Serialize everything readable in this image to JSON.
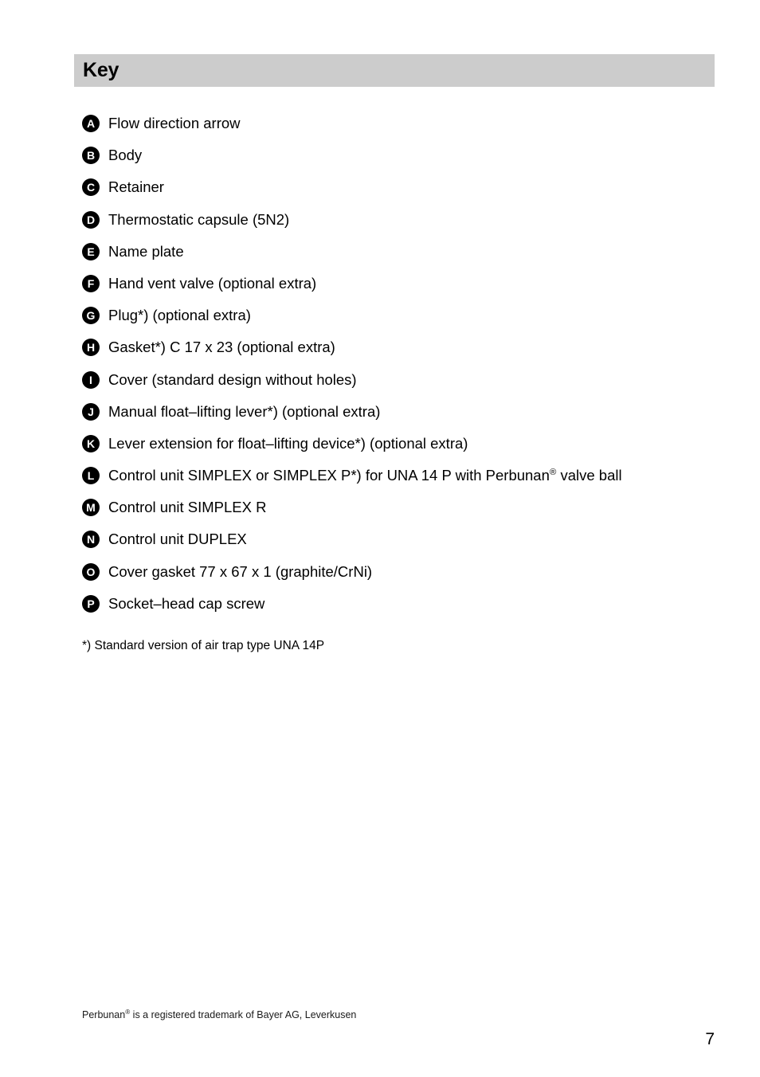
{
  "header": {
    "title": "Key",
    "bar_color": "#cccccc"
  },
  "key_list": [
    {
      "marker": "A",
      "label": "Flow direction arrow"
    },
    {
      "marker": "B",
      "label": "Body"
    },
    {
      "marker": "C",
      "label": "Retainer"
    },
    {
      "marker": "D",
      "label": "Thermostatic capsule (5N2)"
    },
    {
      "marker": "E",
      "label": "Name plate"
    },
    {
      "marker": "F",
      "label": "Hand vent valve (optional extra)"
    },
    {
      "marker": "G",
      "label": "Plug*) (optional extra)"
    },
    {
      "marker": "H",
      "label": "Gasket*) C 17 x 23 (optional extra)"
    },
    {
      "marker": "I",
      "label": "Cover (standard design without holes)"
    },
    {
      "marker": "J",
      "label": "Manual float–lifting lever*) (optional extra)"
    },
    {
      "marker": "K",
      "label": "Lever extension for float–lifting device*) (optional extra)"
    },
    {
      "marker": "L",
      "label_pre": "Control unit SIMPLEX or SIMPLEX P*) for UNA 14 P with Perbunan",
      "label_sup": "®",
      "label_post": " valve ball"
    },
    {
      "marker": "M",
      "label": "Control unit SIMPLEX R"
    },
    {
      "marker": "N",
      "label": "Control unit DUPLEX"
    },
    {
      "marker": "O",
      "label": "Cover gasket 77 x 67 x 1 (graphite/CrNi)"
    },
    {
      "marker": "P",
      "label": "Socket–head cap screw"
    }
  ],
  "footnote": "*) Standard version of air trap type UNA 14P",
  "footer": {
    "trademark_pre": "Perbunan",
    "trademark_sup": "®",
    "trademark_post": " is a registered trademark of Bayer AG, Leverkusen",
    "page_number": "7"
  }
}
